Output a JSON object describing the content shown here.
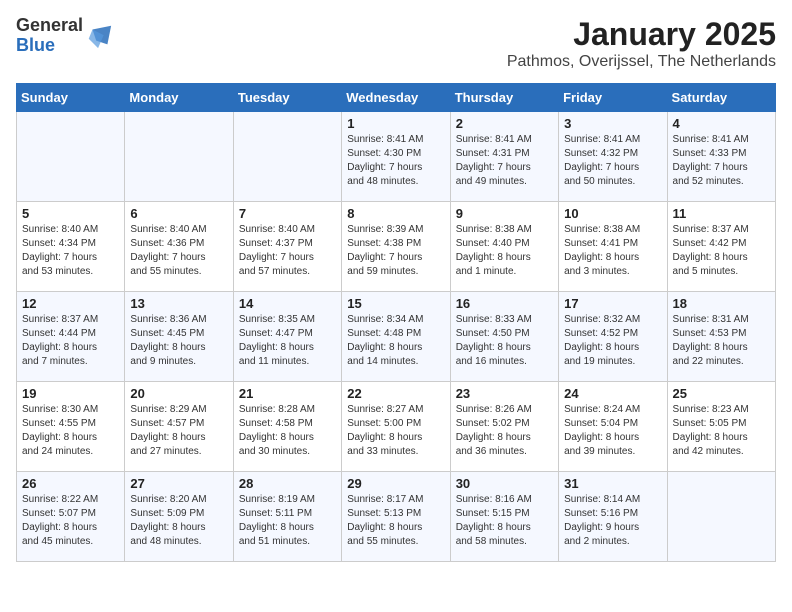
{
  "header": {
    "logo_general": "General",
    "logo_blue": "Blue",
    "month": "January 2025",
    "location": "Pathmos, Overijssel, The Netherlands"
  },
  "weekdays": [
    "Sunday",
    "Monday",
    "Tuesday",
    "Wednesday",
    "Thursday",
    "Friday",
    "Saturday"
  ],
  "weeks": [
    [
      {
        "day": "",
        "info": ""
      },
      {
        "day": "",
        "info": ""
      },
      {
        "day": "",
        "info": ""
      },
      {
        "day": "1",
        "info": "Sunrise: 8:41 AM\nSunset: 4:30 PM\nDaylight: 7 hours\nand 48 minutes."
      },
      {
        "day": "2",
        "info": "Sunrise: 8:41 AM\nSunset: 4:31 PM\nDaylight: 7 hours\nand 49 minutes."
      },
      {
        "day": "3",
        "info": "Sunrise: 8:41 AM\nSunset: 4:32 PM\nDaylight: 7 hours\nand 50 minutes."
      },
      {
        "day": "4",
        "info": "Sunrise: 8:41 AM\nSunset: 4:33 PM\nDaylight: 7 hours\nand 52 minutes."
      }
    ],
    [
      {
        "day": "5",
        "info": "Sunrise: 8:40 AM\nSunset: 4:34 PM\nDaylight: 7 hours\nand 53 minutes."
      },
      {
        "day": "6",
        "info": "Sunrise: 8:40 AM\nSunset: 4:36 PM\nDaylight: 7 hours\nand 55 minutes."
      },
      {
        "day": "7",
        "info": "Sunrise: 8:40 AM\nSunset: 4:37 PM\nDaylight: 7 hours\nand 57 minutes."
      },
      {
        "day": "8",
        "info": "Sunrise: 8:39 AM\nSunset: 4:38 PM\nDaylight: 7 hours\nand 59 minutes."
      },
      {
        "day": "9",
        "info": "Sunrise: 8:38 AM\nSunset: 4:40 PM\nDaylight: 8 hours\nand 1 minute."
      },
      {
        "day": "10",
        "info": "Sunrise: 8:38 AM\nSunset: 4:41 PM\nDaylight: 8 hours\nand 3 minutes."
      },
      {
        "day": "11",
        "info": "Sunrise: 8:37 AM\nSunset: 4:42 PM\nDaylight: 8 hours\nand 5 minutes."
      }
    ],
    [
      {
        "day": "12",
        "info": "Sunrise: 8:37 AM\nSunset: 4:44 PM\nDaylight: 8 hours\nand 7 minutes."
      },
      {
        "day": "13",
        "info": "Sunrise: 8:36 AM\nSunset: 4:45 PM\nDaylight: 8 hours\nand 9 minutes."
      },
      {
        "day": "14",
        "info": "Sunrise: 8:35 AM\nSunset: 4:47 PM\nDaylight: 8 hours\nand 11 minutes."
      },
      {
        "day": "15",
        "info": "Sunrise: 8:34 AM\nSunset: 4:48 PM\nDaylight: 8 hours\nand 14 minutes."
      },
      {
        "day": "16",
        "info": "Sunrise: 8:33 AM\nSunset: 4:50 PM\nDaylight: 8 hours\nand 16 minutes."
      },
      {
        "day": "17",
        "info": "Sunrise: 8:32 AM\nSunset: 4:52 PM\nDaylight: 8 hours\nand 19 minutes."
      },
      {
        "day": "18",
        "info": "Sunrise: 8:31 AM\nSunset: 4:53 PM\nDaylight: 8 hours\nand 22 minutes."
      }
    ],
    [
      {
        "day": "19",
        "info": "Sunrise: 8:30 AM\nSunset: 4:55 PM\nDaylight: 8 hours\nand 24 minutes."
      },
      {
        "day": "20",
        "info": "Sunrise: 8:29 AM\nSunset: 4:57 PM\nDaylight: 8 hours\nand 27 minutes."
      },
      {
        "day": "21",
        "info": "Sunrise: 8:28 AM\nSunset: 4:58 PM\nDaylight: 8 hours\nand 30 minutes."
      },
      {
        "day": "22",
        "info": "Sunrise: 8:27 AM\nSunset: 5:00 PM\nDaylight: 8 hours\nand 33 minutes."
      },
      {
        "day": "23",
        "info": "Sunrise: 8:26 AM\nSunset: 5:02 PM\nDaylight: 8 hours\nand 36 minutes."
      },
      {
        "day": "24",
        "info": "Sunrise: 8:24 AM\nSunset: 5:04 PM\nDaylight: 8 hours\nand 39 minutes."
      },
      {
        "day": "25",
        "info": "Sunrise: 8:23 AM\nSunset: 5:05 PM\nDaylight: 8 hours\nand 42 minutes."
      }
    ],
    [
      {
        "day": "26",
        "info": "Sunrise: 8:22 AM\nSunset: 5:07 PM\nDaylight: 8 hours\nand 45 minutes."
      },
      {
        "day": "27",
        "info": "Sunrise: 8:20 AM\nSunset: 5:09 PM\nDaylight: 8 hours\nand 48 minutes."
      },
      {
        "day": "28",
        "info": "Sunrise: 8:19 AM\nSunset: 5:11 PM\nDaylight: 8 hours\nand 51 minutes."
      },
      {
        "day": "29",
        "info": "Sunrise: 8:17 AM\nSunset: 5:13 PM\nDaylight: 8 hours\nand 55 minutes."
      },
      {
        "day": "30",
        "info": "Sunrise: 8:16 AM\nSunset: 5:15 PM\nDaylight: 8 hours\nand 58 minutes."
      },
      {
        "day": "31",
        "info": "Sunrise: 8:14 AM\nSunset: 5:16 PM\nDaylight: 9 hours\nand 2 minutes."
      },
      {
        "day": "",
        "info": ""
      }
    ]
  ]
}
